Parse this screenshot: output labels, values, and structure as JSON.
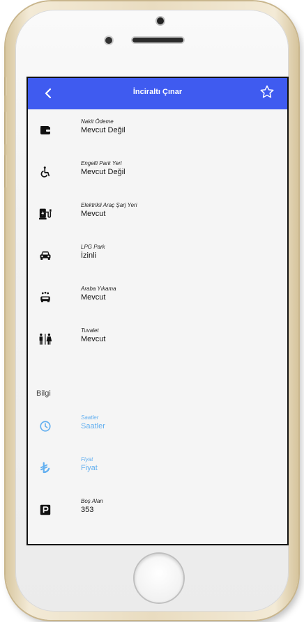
{
  "header": {
    "title": "İnciraltı Çınar"
  },
  "features": [
    {
      "label": "Nakit Ödeme",
      "value": "Mevcut Değil",
      "icon": "wallet-icon"
    },
    {
      "label": "Engelli Park Yeri",
      "value": "Mevcut Değil",
      "icon": "accessible-icon"
    },
    {
      "label": "Elektrikli Araç Şarj Yeri",
      "value": "Mevcut",
      "icon": "ev-charger-icon"
    },
    {
      "label": "LPG Park",
      "value": "İzinli",
      "icon": "car-icon"
    },
    {
      "label": "Araba Yıkama",
      "value": "Mevcut",
      "icon": "car-wash-icon"
    },
    {
      "label": "Tuvalet",
      "value": "Mevcut",
      "icon": "restroom-icon"
    }
  ],
  "info": {
    "section_title": "Bilgi",
    "items": [
      {
        "label": "Saatler",
        "value": "Saatler",
        "icon": "clock-icon"
      },
      {
        "label": "Fiyat",
        "value": "Fiyat",
        "icon": "lira-icon"
      },
      {
        "label": "Boş Alan",
        "value": "353",
        "icon": "parking-icon"
      }
    ]
  },
  "colors": {
    "appbar": "#3f5bf0",
    "link": "#64b0f0"
  }
}
